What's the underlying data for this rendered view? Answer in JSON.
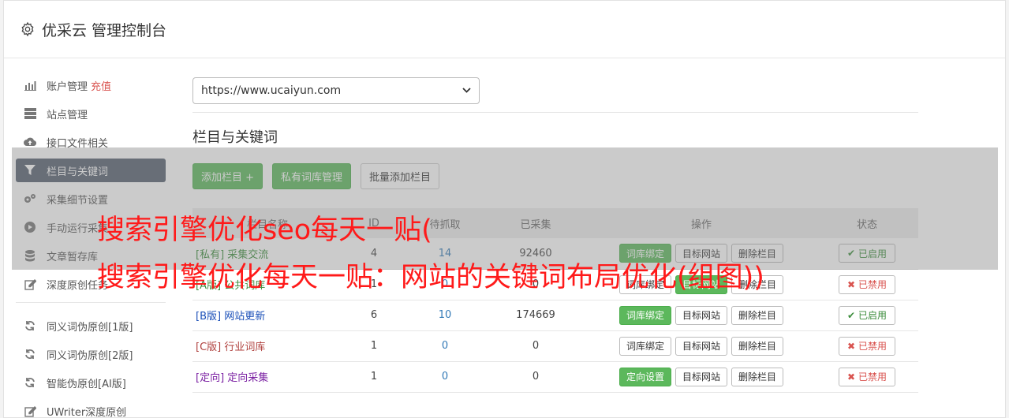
{
  "header": {
    "title": "优采云 管理控制台",
    "icon": "gear-icon"
  },
  "sidebar": {
    "items": [
      {
        "label": "账户管理",
        "extra": "充值",
        "icon": "bar-chart-icon"
      },
      {
        "label": "站点管理",
        "icon": "server-icon"
      },
      {
        "label": "接口文件相关",
        "icon": "cloud-upload-icon"
      },
      {
        "label": "栏目与关键词",
        "icon": "filter-icon",
        "active": true
      },
      {
        "label": "采集细节设置",
        "icon": "cogs-icon"
      },
      {
        "label": "手动运行采集",
        "icon": "play-icon"
      },
      {
        "label": "文章暂存库",
        "icon": "database-icon"
      },
      {
        "label": "深度原创任务",
        "icon": "edit-icon"
      }
    ],
    "items2": [
      {
        "label": "同义词伪原创[1版]",
        "icon": "refresh-icon"
      },
      {
        "label": "同义词伪原创[2版]",
        "icon": "refresh-icon"
      },
      {
        "label": "智能伪原创[AI版]",
        "icon": "refresh-icon"
      },
      {
        "label": "UWriter深度原创",
        "icon": "edit-icon"
      }
    ]
  },
  "site": {
    "selected": "https://www.ucaiyun.com"
  },
  "section": {
    "title": "栏目与关键词"
  },
  "toolbar": {
    "add_column": "添加栏目 +",
    "private_lib": "私有词库管理",
    "batch_add": "批量添加栏目"
  },
  "table": {
    "headers": [
      "栏目名称",
      "ID",
      "待抓取",
      "已采集",
      "操作",
      "状态"
    ],
    "rows": [
      {
        "tag": "[私有]",
        "name": "采集交流",
        "id": "4",
        "pending": "14",
        "collected": "92460",
        "op1": "词库绑定",
        "op2": "目标网站",
        "op3": "删除栏目",
        "status": "已启用"
      },
      {
        "tag": "[A版]",
        "name": "公共词库",
        "id": "1",
        "pending": "0",
        "collected": "0",
        "op1": "词库绑定",
        "op2": "目标网站",
        "op3": "删除栏目",
        "status": "已禁用"
      },
      {
        "tag": "[B版]",
        "name": "网站更新",
        "id": "6",
        "pending": "10",
        "collected": "174669",
        "op1": "词库绑定",
        "op2": "目标网站",
        "op3": "删除栏目",
        "status": "已启用"
      },
      {
        "tag": "[C版]",
        "name": "行业词库",
        "id": "1",
        "pending": "0",
        "collected": "0",
        "op1": "词库绑定",
        "op2": "目标网站",
        "op3": "删除栏目",
        "status": "已禁用"
      },
      {
        "tag": "[定向]",
        "name": "定向采集",
        "id": "1",
        "pending": "0",
        "collected": "0",
        "op1": "定向设置",
        "op2": "目标网站",
        "op3": "删除栏目",
        "status": "已禁用"
      }
    ]
  },
  "watermark": {
    "line1": "搜索引擎优化seo每天一贴(",
    "line2": "搜索引擎优化每天一贴：网站的关键词布局优化(组图))"
  },
  "colors": {
    "accent_green": "#5cb85c",
    "active_nav": "#55606f",
    "danger": "#d9534f",
    "watermark": "#ff1a1a"
  }
}
